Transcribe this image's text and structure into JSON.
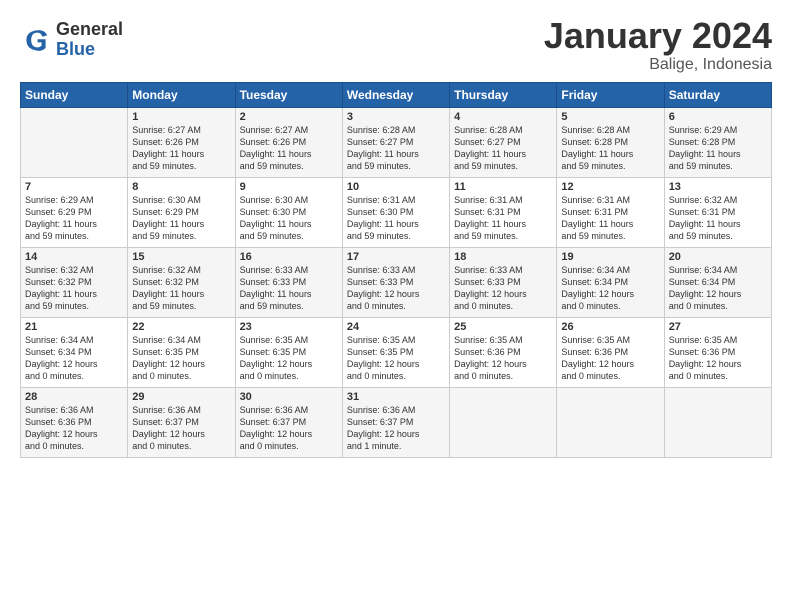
{
  "header": {
    "logo_general": "General",
    "logo_blue": "Blue",
    "month_title": "January 2024",
    "subtitle": "Balige, Indonesia"
  },
  "weekdays": [
    "Sunday",
    "Monday",
    "Tuesday",
    "Wednesday",
    "Thursday",
    "Friday",
    "Saturday"
  ],
  "weeks": [
    [
      {
        "day": "",
        "info": ""
      },
      {
        "day": "1",
        "info": "Sunrise: 6:27 AM\nSunset: 6:26 PM\nDaylight: 11 hours\nand 59 minutes."
      },
      {
        "day": "2",
        "info": "Sunrise: 6:27 AM\nSunset: 6:26 PM\nDaylight: 11 hours\nand 59 minutes."
      },
      {
        "day": "3",
        "info": "Sunrise: 6:28 AM\nSunset: 6:27 PM\nDaylight: 11 hours\nand 59 minutes."
      },
      {
        "day": "4",
        "info": "Sunrise: 6:28 AM\nSunset: 6:27 PM\nDaylight: 11 hours\nand 59 minutes."
      },
      {
        "day": "5",
        "info": "Sunrise: 6:28 AM\nSunset: 6:28 PM\nDaylight: 11 hours\nand 59 minutes."
      },
      {
        "day": "6",
        "info": "Sunrise: 6:29 AM\nSunset: 6:28 PM\nDaylight: 11 hours\nand 59 minutes."
      }
    ],
    [
      {
        "day": "7",
        "info": "Sunrise: 6:29 AM\nSunset: 6:29 PM\nDaylight: 11 hours\nand 59 minutes."
      },
      {
        "day": "8",
        "info": "Sunrise: 6:30 AM\nSunset: 6:29 PM\nDaylight: 11 hours\nand 59 minutes."
      },
      {
        "day": "9",
        "info": "Sunrise: 6:30 AM\nSunset: 6:30 PM\nDaylight: 11 hours\nand 59 minutes."
      },
      {
        "day": "10",
        "info": "Sunrise: 6:31 AM\nSunset: 6:30 PM\nDaylight: 11 hours\nand 59 minutes."
      },
      {
        "day": "11",
        "info": "Sunrise: 6:31 AM\nSunset: 6:31 PM\nDaylight: 11 hours\nand 59 minutes."
      },
      {
        "day": "12",
        "info": "Sunrise: 6:31 AM\nSunset: 6:31 PM\nDaylight: 11 hours\nand 59 minutes."
      },
      {
        "day": "13",
        "info": "Sunrise: 6:32 AM\nSunset: 6:31 PM\nDaylight: 11 hours\nand 59 minutes."
      }
    ],
    [
      {
        "day": "14",
        "info": "Sunrise: 6:32 AM\nSunset: 6:32 PM\nDaylight: 11 hours\nand 59 minutes."
      },
      {
        "day": "15",
        "info": "Sunrise: 6:32 AM\nSunset: 6:32 PM\nDaylight: 11 hours\nand 59 minutes."
      },
      {
        "day": "16",
        "info": "Sunrise: 6:33 AM\nSunset: 6:33 PM\nDaylight: 11 hours\nand 59 minutes."
      },
      {
        "day": "17",
        "info": "Sunrise: 6:33 AM\nSunset: 6:33 PM\nDaylight: 12 hours\nand 0 minutes."
      },
      {
        "day": "18",
        "info": "Sunrise: 6:33 AM\nSunset: 6:33 PM\nDaylight: 12 hours\nand 0 minutes."
      },
      {
        "day": "19",
        "info": "Sunrise: 6:34 AM\nSunset: 6:34 PM\nDaylight: 12 hours\nand 0 minutes."
      },
      {
        "day": "20",
        "info": "Sunrise: 6:34 AM\nSunset: 6:34 PM\nDaylight: 12 hours\nand 0 minutes."
      }
    ],
    [
      {
        "day": "21",
        "info": "Sunrise: 6:34 AM\nSunset: 6:34 PM\nDaylight: 12 hours\nand 0 minutes."
      },
      {
        "day": "22",
        "info": "Sunrise: 6:34 AM\nSunset: 6:35 PM\nDaylight: 12 hours\nand 0 minutes."
      },
      {
        "day": "23",
        "info": "Sunrise: 6:35 AM\nSunset: 6:35 PM\nDaylight: 12 hours\nand 0 minutes."
      },
      {
        "day": "24",
        "info": "Sunrise: 6:35 AM\nSunset: 6:35 PM\nDaylight: 12 hours\nand 0 minutes."
      },
      {
        "day": "25",
        "info": "Sunrise: 6:35 AM\nSunset: 6:36 PM\nDaylight: 12 hours\nand 0 minutes."
      },
      {
        "day": "26",
        "info": "Sunrise: 6:35 AM\nSunset: 6:36 PM\nDaylight: 12 hours\nand 0 minutes."
      },
      {
        "day": "27",
        "info": "Sunrise: 6:35 AM\nSunset: 6:36 PM\nDaylight: 12 hours\nand 0 minutes."
      }
    ],
    [
      {
        "day": "28",
        "info": "Sunrise: 6:36 AM\nSunset: 6:36 PM\nDaylight: 12 hours\nand 0 minutes."
      },
      {
        "day": "29",
        "info": "Sunrise: 6:36 AM\nSunset: 6:37 PM\nDaylight: 12 hours\nand 0 minutes."
      },
      {
        "day": "30",
        "info": "Sunrise: 6:36 AM\nSunset: 6:37 PM\nDaylight: 12 hours\nand 0 minutes."
      },
      {
        "day": "31",
        "info": "Sunrise: 6:36 AM\nSunset: 6:37 PM\nDaylight: 12 hours\nand 1 minute."
      },
      {
        "day": "",
        "info": ""
      },
      {
        "day": "",
        "info": ""
      },
      {
        "day": "",
        "info": ""
      }
    ]
  ]
}
